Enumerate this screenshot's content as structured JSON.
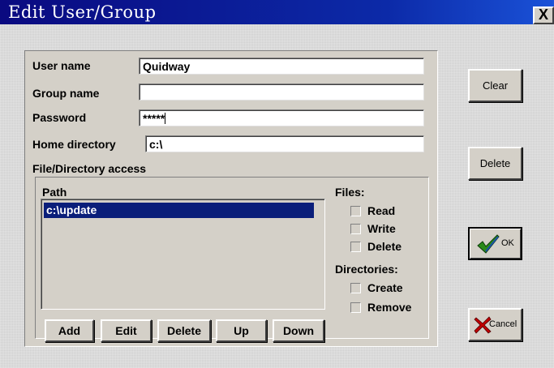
{
  "window": {
    "title": "Edit User/Group",
    "close_label": "X"
  },
  "form": {
    "user_name_label": "User name",
    "user_name_value": "Quidway",
    "group_name_label": "Group name",
    "group_name_value": "",
    "password_label": "Password",
    "password_value": "*****",
    "home_dir_label": "Home directory",
    "home_dir_value": "c:\\"
  },
  "access": {
    "section_label": "File/Directory access",
    "path_label": "Path",
    "paths": [
      "c:\\update"
    ],
    "files_label": "Files:",
    "files_options": [
      "Read",
      "Write",
      "Delete"
    ],
    "directories_label": "Directories:",
    "directories_options": [
      "Create",
      "Remove"
    ]
  },
  "list_buttons": {
    "add": "Add",
    "edit": "Edit",
    "delete": "Delete",
    "up": "Up",
    "down": "Down"
  },
  "side_buttons": {
    "clear": "Clear",
    "delete": "Delete",
    "ok": "OK",
    "cancel": "Cancel"
  },
  "icons": {
    "ok": "checkmark-icon",
    "cancel": "red-x-icon"
  },
  "colors": {
    "title_bar": "#0a0a80",
    "selection": "#0a1e7a",
    "ok_check": "#2a8a1a",
    "cancel_x": "#c00000"
  }
}
